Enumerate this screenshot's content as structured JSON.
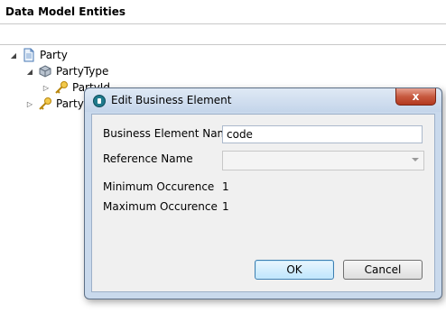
{
  "panel": {
    "title": "Data Model Entities"
  },
  "tree": {
    "root": "Party",
    "child_type": "PartyType",
    "child_partial": "PartyId",
    "sibling_partial": "Party"
  },
  "dialog": {
    "title": "Edit Business Element",
    "close_label": "x",
    "fields": {
      "business_element_name_label": "Business Element Name",
      "business_element_name_value": "code",
      "reference_name_label": "Reference Name",
      "reference_name_value": "",
      "minimum_occurence_label": "Minimum Occurence",
      "minimum_occurence_value": "1",
      "maximum_occurence_label": "Maximum Occurence",
      "maximum_occurence_value": "1"
    },
    "ok_label": "OK",
    "cancel_label": "Cancel"
  },
  "icons": [
    "document-icon",
    "cube-icon",
    "key-icon",
    "tree-expanded-icon",
    "tree-collapsed-icon",
    "app-icon",
    "close-icon",
    "dropdown-arrow-icon"
  ],
  "colors": {
    "dialog_frame": "#c9d9ec",
    "close_button": "#c75a40",
    "default_button": "#bee6fd"
  }
}
